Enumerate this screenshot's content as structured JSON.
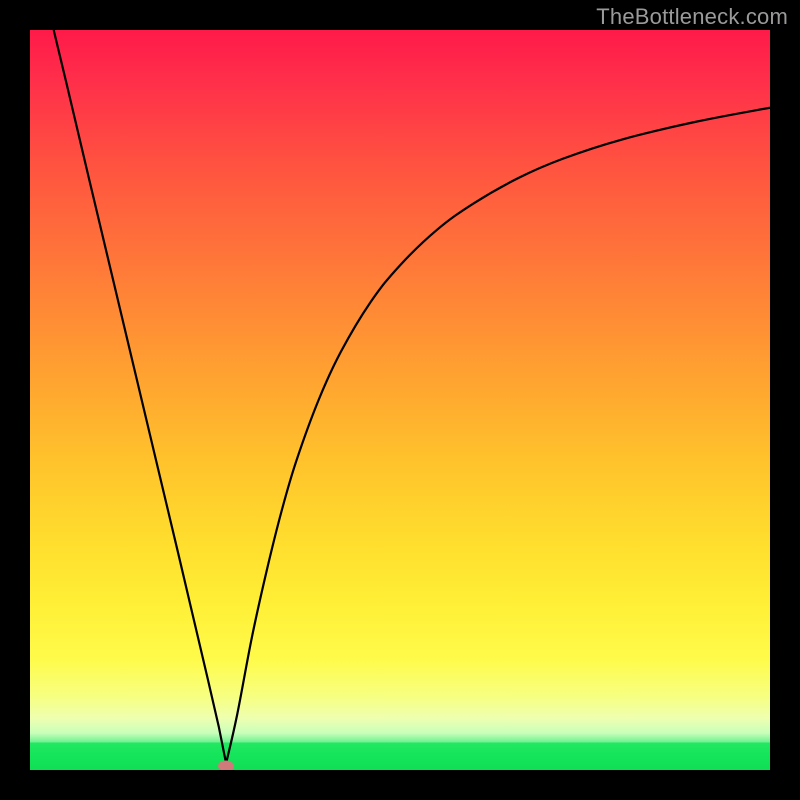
{
  "watermark": "TheBottleneck.com",
  "colors": {
    "page_bg": "#000000",
    "watermark": "#9a9a9a",
    "curve": "#000000",
    "marker": "#cf7b79",
    "gradient_top": "#ff1a49",
    "gradient_mid": "#ffdb2d",
    "gradient_bottom": "#10df55"
  },
  "chart_data": {
    "type": "line",
    "title": "",
    "xlabel": "",
    "ylabel": "",
    "xlim": [
      0,
      100
    ],
    "ylim": [
      0,
      100
    ],
    "grid": false,
    "legend": false,
    "annotations": [
      {
        "type": "marker",
        "x": 26.5,
        "y": 0.6,
        "shape": "ellipse",
        "color": "#cf7b79"
      }
    ],
    "series": [
      {
        "name": "descending-left",
        "x": [
          3.2,
          5,
          8,
          11,
          14,
          17,
          20,
          22,
          24,
          25.5,
          26.5
        ],
        "y": [
          100,
          92.5,
          79.8,
          67.2,
          54.6,
          42.0,
          29.4,
          20.9,
          12.4,
          5.9,
          0.9
        ]
      },
      {
        "name": "rising-right",
        "x": [
          26.5,
          28,
          30,
          32,
          34,
          36,
          39,
          42,
          46,
          50,
          55,
          60,
          66,
          72,
          80,
          90,
          100
        ],
        "y": [
          0.9,
          7.5,
          18.0,
          27.0,
          35.0,
          41.8,
          50.0,
          56.5,
          63.2,
          68.2,
          73.0,
          76.6,
          80.0,
          82.6,
          85.2,
          87.6,
          89.5
        ]
      }
    ],
    "background": {
      "type": "vertical-gradient",
      "stops": [
        {
          "pos": 0.0,
          "color": "#ff1a49"
        },
        {
          "pos": 0.33,
          "color": "#ff8a34"
        },
        {
          "pos": 0.68,
          "color": "#ffdb2d"
        },
        {
          "pos": 0.9,
          "color": "#f5ff8a"
        },
        {
          "pos": 0.965,
          "color": "#23e862"
        },
        {
          "pos": 1.0,
          "color": "#10df55"
        }
      ]
    }
  }
}
